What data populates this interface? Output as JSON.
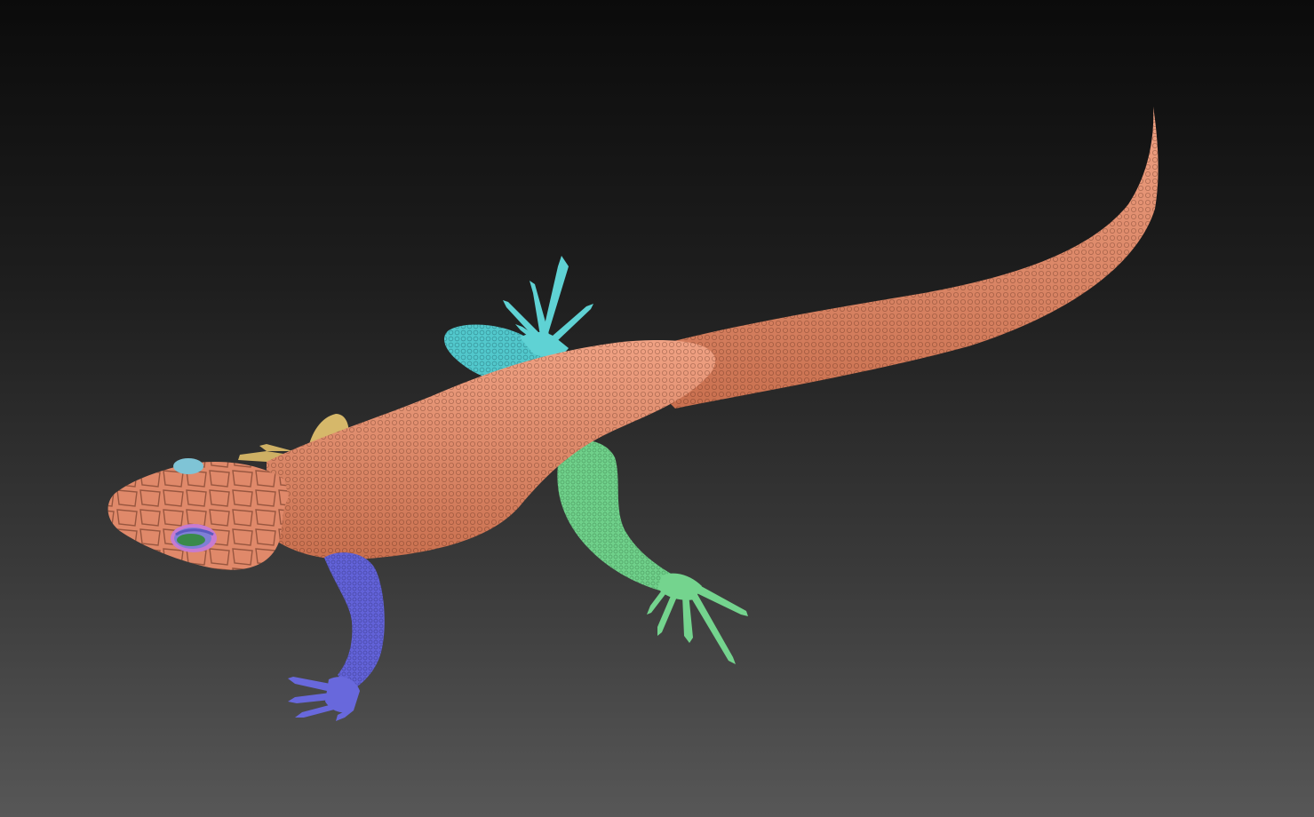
{
  "viewport": {
    "background_top": "#0b0b0b",
    "background_bottom": "#575757"
  },
  "model": {
    "subject": "lizard",
    "polygroups": [
      {
        "part": "head-body-tail",
        "color": "#e0896a"
      },
      {
        "part": "front-left-leg",
        "color": "#6262d8"
      },
      {
        "part": "front-right-leg",
        "color": "#d6b86a"
      },
      {
        "part": "rear-left-leg",
        "color": "#6fd08a"
      },
      {
        "part": "rear-right-leg",
        "color": "#52c8cc"
      },
      {
        "part": "eye",
        "color": "#3a8a4a"
      },
      {
        "part": "eyelid",
        "color": "#7f7fd6"
      }
    ]
  }
}
